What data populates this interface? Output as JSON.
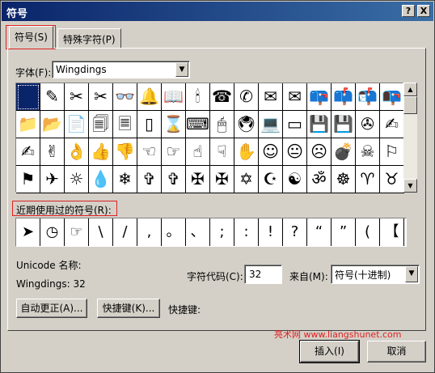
{
  "window": {
    "title": "符号",
    "help_label": "?",
    "close_label": "X"
  },
  "tabs": [
    {
      "label": "符号(S)",
      "active": true
    },
    {
      "label": "特殊字符(P)",
      "active": false
    }
  ],
  "font": {
    "label": "字体(F):",
    "value": "Wingdings"
  },
  "symbol_grid": {
    "rows": [
      [
        "",
        "✎",
        "✂",
        "✂",
        "👓",
        "🔔",
        "📖",
        "🕯",
        "☎",
        "✆",
        "✉",
        "✉",
        "📪",
        "📫",
        "📬",
        "📭"
      ],
      [
        "📁",
        "📂",
        "📄",
        "🗐",
        "🗏",
        "▯",
        "⌛",
        "⌨",
        "🖱",
        "🖲",
        "💻",
        "▭",
        "💾",
        "💾",
        "✇",
        "✍"
      ],
      [
        "✍",
        "✌",
        "👌",
        "👍",
        "👎",
        "☜",
        "☞",
        "☝",
        "☟",
        "✋",
        "☺",
        "😐",
        "☹",
        "💣",
        "☠",
        "⚐"
      ],
      [
        "⚑",
        "✈",
        "☼",
        "💧",
        "❄",
        "✞",
        "✞",
        "✠",
        "✠",
        "✡",
        "☪",
        "☯",
        "ॐ",
        "☸",
        "♈",
        "♉"
      ]
    ],
    "selected_index": 0
  },
  "recent": {
    "label": "近期使用过的符号(R):",
    "items": [
      "➤",
      "◷",
      "☞",
      "\\",
      "/",
      ",",
      "。",
      "、",
      ";",
      ":",
      "!",
      "?",
      "“",
      "”",
      "(",
      "【"
    ]
  },
  "unicode_name_label": "Unicode 名称:",
  "symbol_desc": "Wingdings: 32",
  "char_code": {
    "label": "字符代码(C):",
    "value": "32"
  },
  "from": {
    "label": "来自(M):",
    "value": "符号(十进制)"
  },
  "buttons": {
    "autocorrect": "自动更正(A)...",
    "shortcut_key": "快捷键(K)...",
    "insert": "插入(I)",
    "cancel": "取消"
  },
  "shortcut_label": "快捷键:",
  "watermark": "亮术网 www.liangshunet.com",
  "colors": {
    "title_start": "#0a246a",
    "title_end": "#3a6ea5",
    "highlight": "#e02020",
    "face": "#d4d0c8"
  }
}
